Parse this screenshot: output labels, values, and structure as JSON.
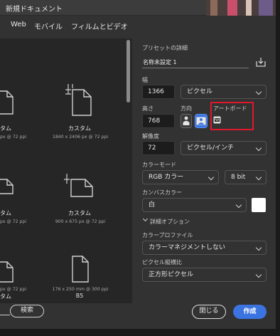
{
  "window": {
    "title": "新規ドキュメント"
  },
  "tabs": [
    {
      "label": "Web"
    },
    {
      "label": "モバイル"
    },
    {
      "label": "フィルムとビデオ"
    }
  ],
  "gallery": {
    "items": [
      {
        "name": "タム",
        "size": "px @ 72 ppi"
      },
      {
        "name": "カスタム",
        "size": "1840 x 2406 px @ 72 ppi"
      },
      {
        "name": "タム",
        "size": "px @ 72 ppi"
      },
      {
        "name": "カスタム",
        "size": "900 x 675 px @ 72 ppi"
      },
      {
        "name": "タム",
        "size": "px @ 72 ppi"
      },
      {
        "name": "B5",
        "size": "176 x 250 mm @ 300 ppi"
      }
    ],
    "search_label": "検索"
  },
  "preset": {
    "heading": "プリセットの詳細",
    "name": "名称未設定 1",
    "width_label": "幅",
    "width_value": "1366",
    "width_unit": "ピクセル",
    "height_label": "高さ",
    "height_value": "768",
    "orientation_label": "方向",
    "artboard_label": "アートボード",
    "artboard_checked": false,
    "resolution_label": "解像度",
    "resolution_value": "72",
    "resolution_unit": "ピクセル/インチ",
    "color_mode_label": "カラーモード",
    "color_mode_value": "RGB カラー",
    "bit_depth": "8 bit",
    "canvas_color_label": "カンバスカラー",
    "canvas_color_value": "白",
    "canvas_color_hex": "#ffffff",
    "advanced_label": "詳細オプション",
    "color_profile_label": "カラープロファイル",
    "color_profile_value": "カラーマネジメントしない",
    "pixel_aspect_label": "ピクセル縦横比",
    "pixel_aspect_value": "正方形ピクセル"
  },
  "actions": {
    "close": "閉じる",
    "create": "作成"
  },
  "colors": {
    "accent": "#3b74e0",
    "highlight": "#e0182d",
    "background": "#323232"
  }
}
